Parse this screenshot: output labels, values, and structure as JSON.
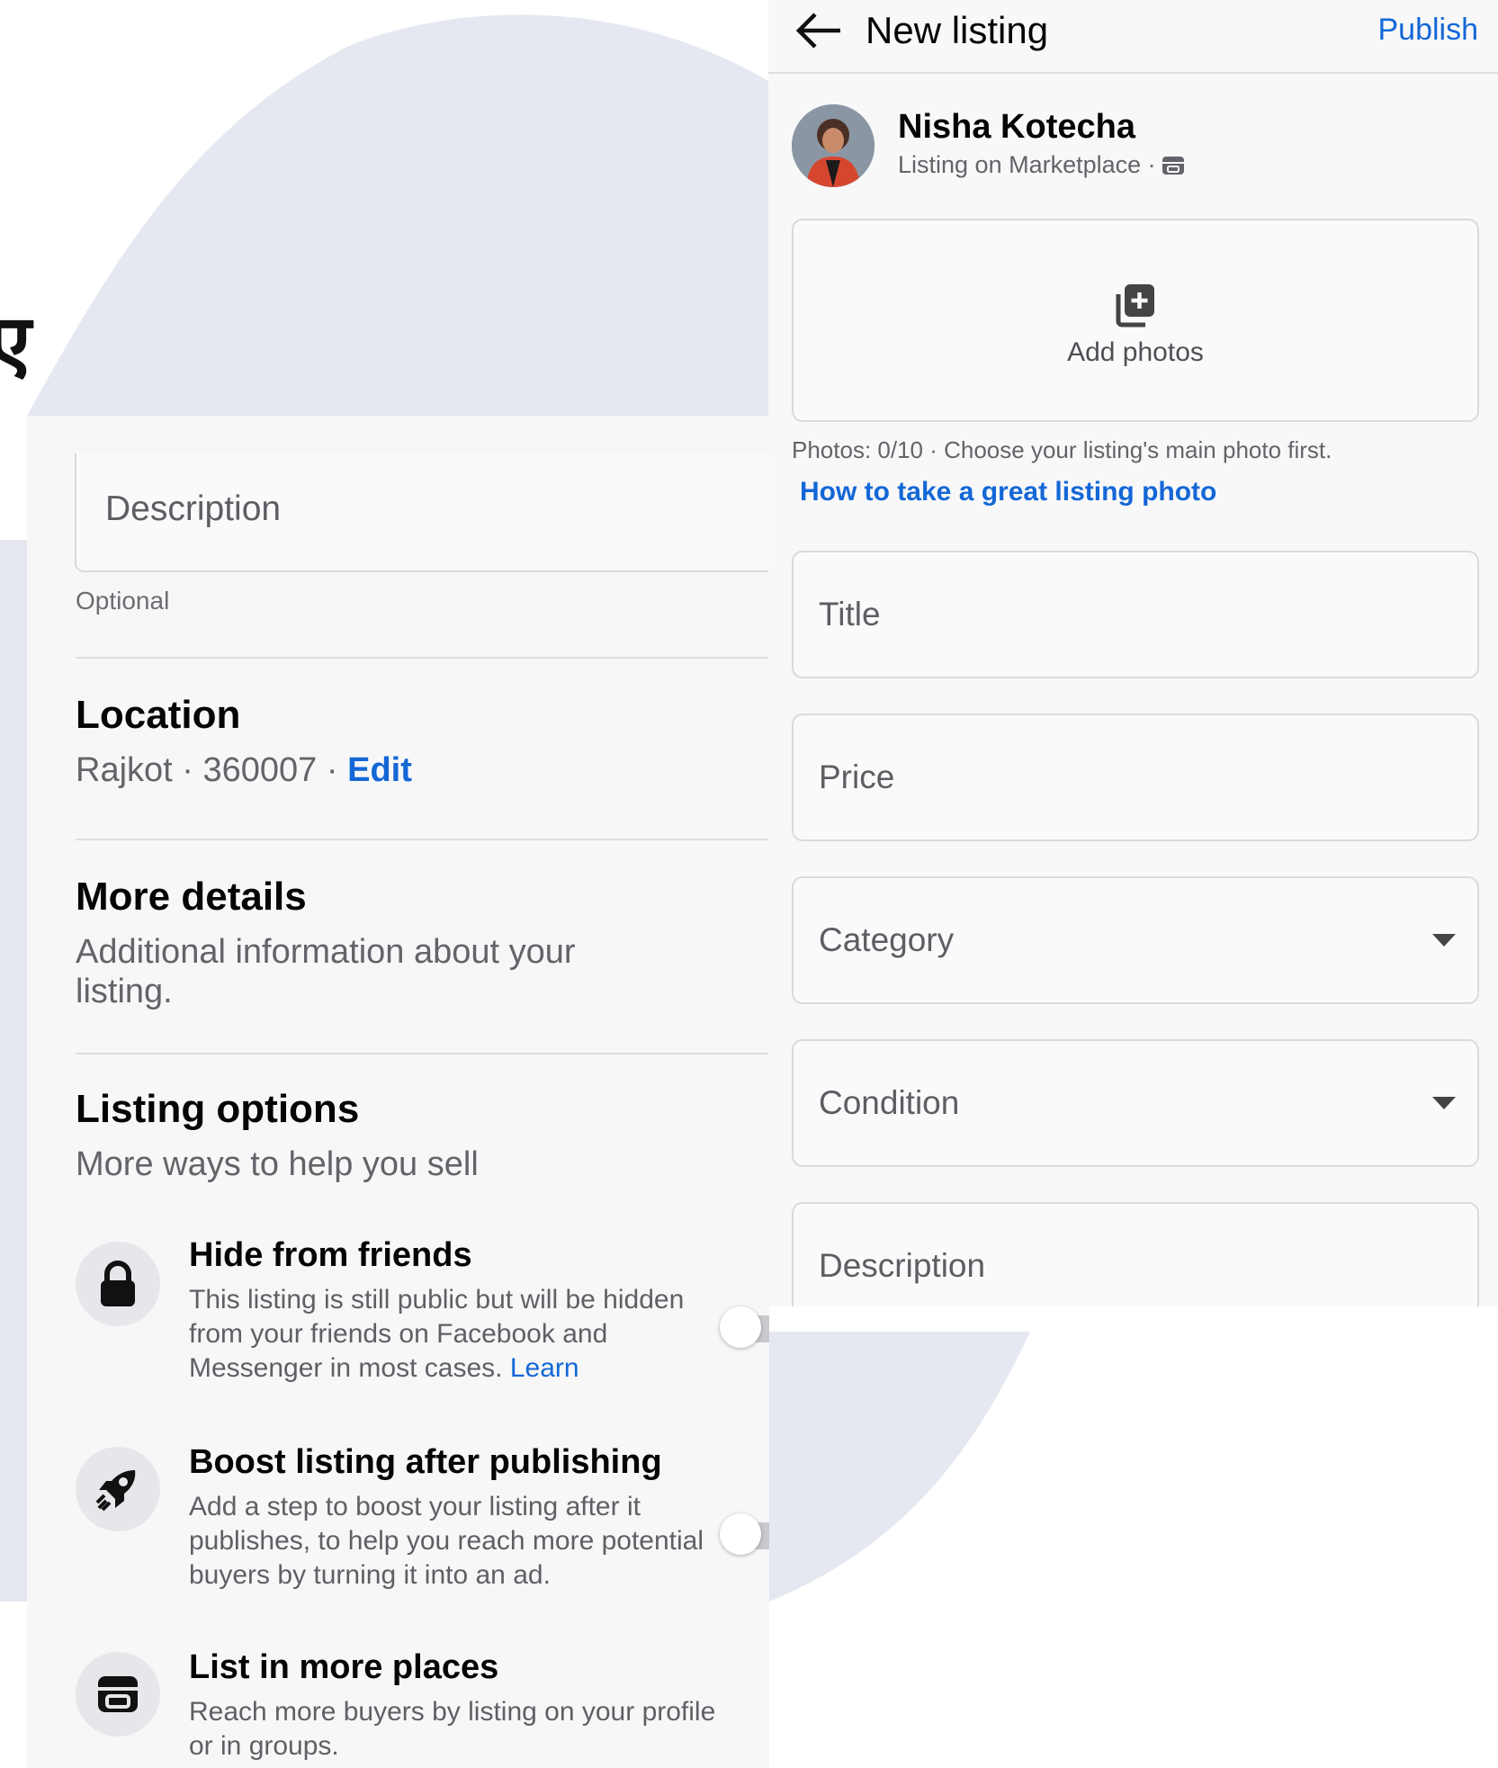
{
  "background": {
    "blob_color": "#e6e8f1",
    "fragment_text": "ए"
  },
  "left_panel": {
    "description_placeholder": "Description",
    "optional_note": "Optional",
    "location": {
      "title": "Location",
      "city": "Rajkot",
      "postal_code": "360007",
      "separator": "·",
      "edit_label": "Edit"
    },
    "more_details": {
      "title": "More details",
      "subtitle": "Additional information about your listing."
    },
    "listing_options": {
      "title": "Listing options",
      "subtitle": "More ways to help you sell",
      "items": [
        {
          "icon": "lock-icon",
          "title": "Hide from friends",
          "text": "This listing is still public but will be hidden from your friends on Facebook and Messenger in most cases.",
          "link": "Learn",
          "control": "toggle",
          "enabled": false
        },
        {
          "icon": "rocket-icon",
          "title": "Boost listing after publishing",
          "text": "Add a step to boost your listing after it publishes, to help you reach more potential buyers by turning it into an ad.",
          "control": "toggle",
          "enabled": false
        },
        {
          "icon": "storefront-icon",
          "title": "List in more places",
          "text": "Reach more buyers by listing on your profile or in groups.",
          "control": "chevron-right-icon"
        }
      ]
    }
  },
  "right_panel": {
    "header": {
      "title": "New listing",
      "publish_label": "Publish"
    },
    "user": {
      "name": "Nisha Kotecha",
      "subtitle": "Listing on Marketplace ·"
    },
    "photos": {
      "add_label": "Add photos",
      "count_note": "Photos: 0/10 · Choose your listing's main photo first.",
      "tip_link": "How to take a great listing photo"
    },
    "fields": {
      "title_placeholder": "Title",
      "price_placeholder": "Price",
      "category_placeholder": "Category",
      "condition_placeholder": "Condition",
      "description_placeholder": "Description"
    }
  },
  "colors": {
    "accent_blue": "#1467d6",
    "panel_bg": "#f7f7f8",
    "border": "#d9dadd"
  }
}
